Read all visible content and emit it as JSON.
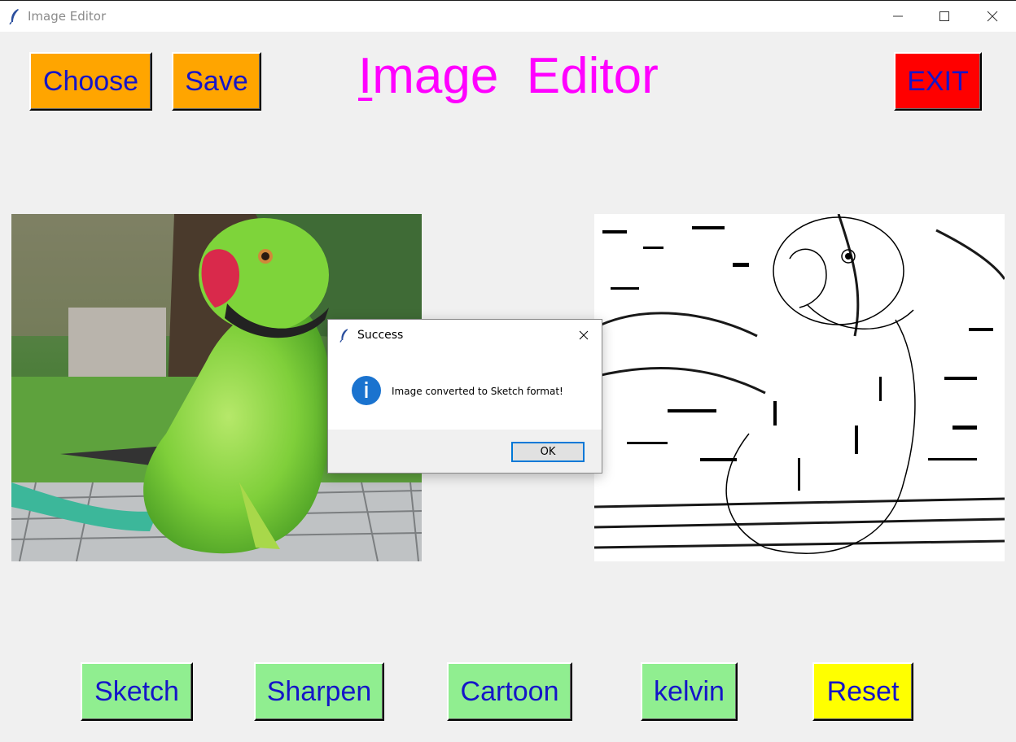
{
  "window": {
    "title": "Image Editor"
  },
  "toolbar": {
    "choose_label": "Choose",
    "save_label": "Save",
    "exit_label": "EXIT"
  },
  "header": {
    "title_first_letter": "I",
    "title_rest": "mage  Editor"
  },
  "filters": [
    {
      "label": "Sketch"
    },
    {
      "label": "Sharpen"
    },
    {
      "label": "Cartoon"
    },
    {
      "label": "kelvin"
    },
    {
      "label": "Reset"
    }
  ],
  "dialog": {
    "title": "Success",
    "message": "Image converted to Sketch format!",
    "ok_label": "OK",
    "icon": "info-icon"
  },
  "colors": {
    "title": "#ff00ff",
    "button_text": "#1515c8",
    "choose_save_bg": "#ffa500",
    "exit_bg": "#ff0000",
    "filter_bg": "#90ee90",
    "reset_bg": "#ffff00",
    "background": "#f0f0f0"
  }
}
